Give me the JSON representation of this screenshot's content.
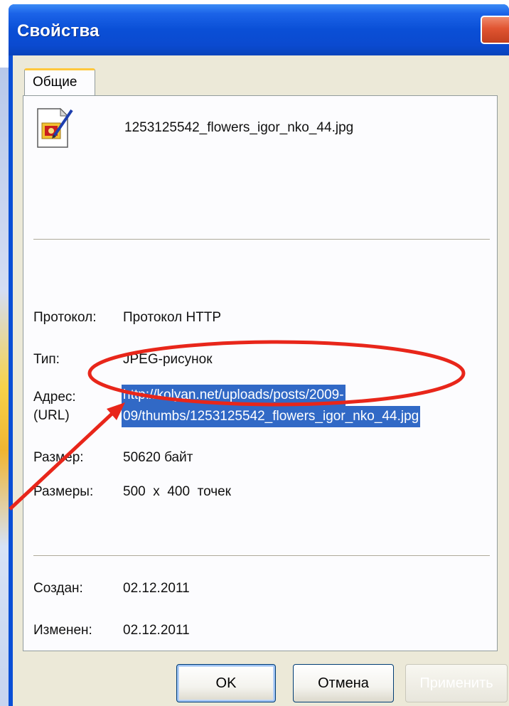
{
  "window": {
    "title": "Свойства"
  },
  "tabs": [
    {
      "label": "Общие"
    }
  ],
  "file": {
    "name": "1253125542_flowers_igor_nko_44.jpg",
    "icon": "jpeg-file-icon"
  },
  "properties": {
    "protocol_label": "Протокол:",
    "protocol_value": "Протокол HTTP",
    "type_label": "Тип:",
    "type_value": "JPEG-рисунок",
    "address_label": "Адрес:",
    "address_label_2": "(URL)",
    "address_line_1": "http://kolyan.net/uploads/posts/2009-",
    "address_line_2": "09/thumbs/1253125542_flowers_igor_nko_44.jpg",
    "size_label": "Размер:",
    "size_value": "50620 байт",
    "dimensions_label": "Размеры:",
    "dimensions_value": "500  x  400  точек",
    "created_label": "Создан:",
    "created_value": "02.12.2011",
    "modified_label": "Изменен:",
    "modified_value": "02.12.2011"
  },
  "buttons": {
    "ok": "OK",
    "cancel": "Отмена",
    "apply": "Применить"
  },
  "colors": {
    "titlebar": "#0a4fd6",
    "selection": "#3169c6",
    "annotation": "#e8261a",
    "dialog_background": "#ece9d8"
  }
}
